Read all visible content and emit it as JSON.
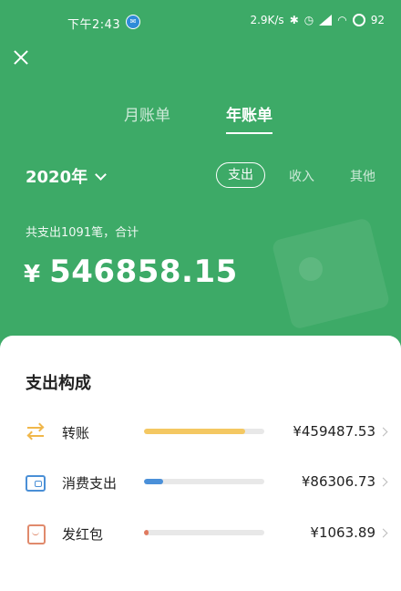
{
  "status_bar": {
    "time": "下午2:43",
    "network_speed": "2.9K/s",
    "battery": "92"
  },
  "tabs": [
    {
      "label": "月账单",
      "active": false
    },
    {
      "label": "年账单",
      "active": true
    }
  ],
  "year_selector": {
    "value": "2020年"
  },
  "filters": [
    {
      "label": "支出",
      "active": true
    },
    {
      "label": "收入",
      "active": false
    },
    {
      "label": "其他",
      "active": false
    }
  ],
  "summary": {
    "text": "共支出1091笔，合计",
    "currency": "¥",
    "amount": "546858.15"
  },
  "breakdown": {
    "title": "支出构成",
    "items": [
      {
        "label": "转账",
        "amount": "¥459487.53",
        "share": 0.84,
        "color": "#f4c862",
        "icon": "transfer-icon"
      },
      {
        "label": "消费支出",
        "amount": "¥86306.73",
        "share": 0.16,
        "color": "#4a90d9",
        "icon": "wallet-icon"
      },
      {
        "label": "发红包",
        "amount": "¥1063.89",
        "share": 0.02,
        "color": "#e07a5f",
        "icon": "red-packet-icon"
      }
    ]
  },
  "colors": {
    "background": "#3daa67",
    "card": "#ffffff"
  }
}
